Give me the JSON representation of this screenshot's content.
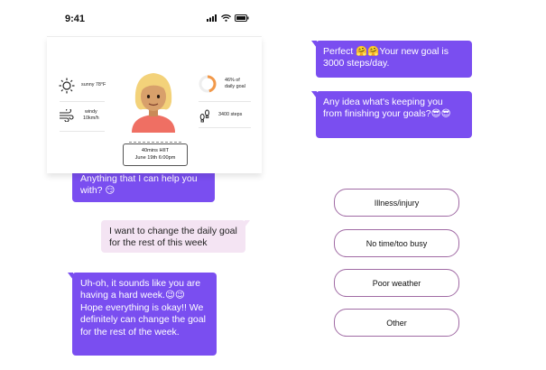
{
  "status_bar": {
    "time": "9:41"
  },
  "dashboard": {
    "weather": {
      "text": "sunny 78°F",
      "icon": "sun-icon"
    },
    "wind": {
      "line1": "windy",
      "line2": "10km/h",
      "icon": "wind-icon"
    },
    "goal": {
      "line1": "46% of",
      "line2": "daily goal",
      "progress_fraction": 0.46,
      "icon": "progress-ring-icon"
    },
    "steps": {
      "text": "3400 steps",
      "icon": "footprints-icon"
    },
    "session": {
      "line1": "40mins HIIT",
      "line2": "June 19th 6:00pm"
    }
  },
  "chat": {
    "bot_1": "Anything that I can help you with? 😏",
    "user_1": "I want to change the daily goal for the rest of this week",
    "bot_2": "Uh-oh, it sounds like you are having a hard week.😉😉 Hope everything is okay!! We definitely can change the goal for the rest of the week.",
    "bot_3": "Perfect 🤗🤗Your new goal is 3000 steps/day.",
    "bot_4": "Any idea what's keeping you from finishing your goals?😎😎"
  },
  "options": [
    "Illness/injury",
    "No time/too busy",
    "Poor weather",
    "Other"
  ],
  "colors": {
    "bot_bubble": "#7a4ef0",
    "user_bubble": "#f4e4f3",
    "option_border": "#a06aa4",
    "ring_progress": "#f2994a"
  }
}
